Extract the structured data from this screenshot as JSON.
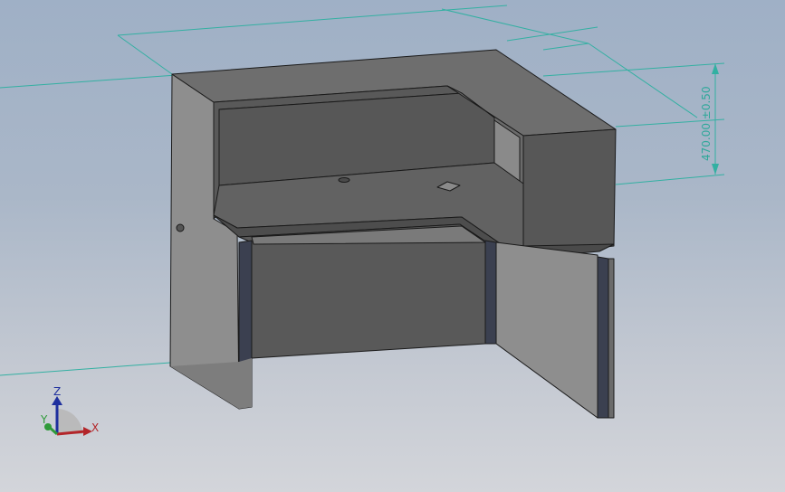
{
  "dimension": {
    "text": "470.00 ±0.50",
    "color": "#2fa89a"
  },
  "triad": {
    "x_label": "X",
    "y_label": "Y",
    "z_label": "Z",
    "x_color": "#b3262a",
    "y_color": "#2f9a3a",
    "z_color": "#1e2f9e"
  },
  "model": {
    "face_top_color": "#6b6b6b",
    "face_front_color": "#575757",
    "face_side_color": "#8c8c8c",
    "edge_color": "#1a1a1a",
    "panel_edge_color": "#3a3f4e"
  }
}
